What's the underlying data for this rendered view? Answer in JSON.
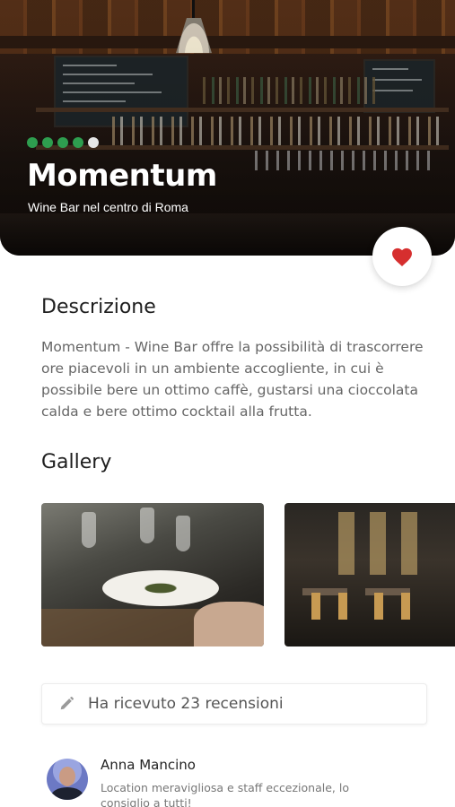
{
  "venue": {
    "name": "Momentum",
    "subtitle": "Wine Bar nel centro di Roma",
    "rating": 4,
    "rating_max": 5,
    "favorite": true
  },
  "description": {
    "title": "Descrizione",
    "text": "Momentum - Wine Bar offre la possibilità di trascorrere ore piacevoli in un ambiente accogliente, in cui è possibile bere un ottimo caffè, gustarsi una cioccolata calda e bere ottimo cocktail alla frutta."
  },
  "gallery": {
    "title": "Gallery",
    "photos": [
      "restaurant-table-photo",
      "restaurant-interior-photo"
    ]
  },
  "reviews": {
    "summary": "Ha ricevuto 23 recensioni",
    "items": [
      {
        "author": "Anna Mancino",
        "text": "Location meravigliosa e staff eccezionale, lo consiglio a tutti!"
      }
    ]
  },
  "colors": {
    "rating_green": "#2e9e4f",
    "heart_red": "#d62f2f"
  }
}
